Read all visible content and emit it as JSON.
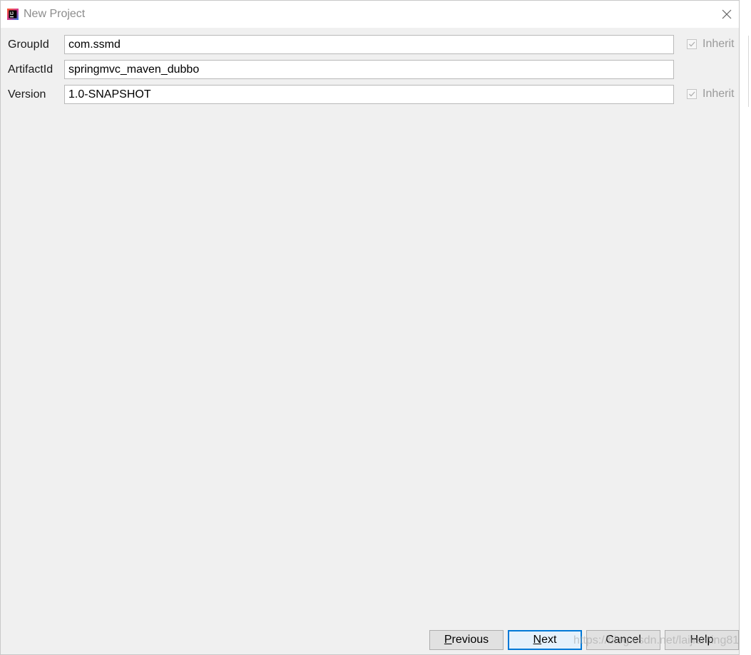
{
  "window": {
    "title": "New Project"
  },
  "form": {
    "group_id": {
      "label": "GroupId",
      "value": "com.ssmd",
      "inherit_label": "Inherit",
      "inherit_checked": true
    },
    "artifact_id": {
      "label": "ArtifactId",
      "value": "springmvc_maven_dubbo"
    },
    "version": {
      "label": "Version",
      "value": "1.0-SNAPSHOT",
      "inherit_label": "Inherit",
      "inherit_checked": true
    }
  },
  "buttons": {
    "previous": {
      "label": "Previous",
      "mnemonic": "P",
      "rest": "revious"
    },
    "next": {
      "label": "Next",
      "mnemonic": "N",
      "rest": "ext"
    },
    "cancel": {
      "label": "Cancel"
    },
    "help": {
      "label": "Help"
    }
  },
  "watermark": "https://blog.csdn.net/laijiaming816",
  "icons": {
    "app": "intellij-idea-icon",
    "close": "close-icon",
    "check": "checkmark-icon"
  },
  "colors": {
    "primary_button_border": "#0078d7",
    "panel_background": "#f0f0f0"
  }
}
